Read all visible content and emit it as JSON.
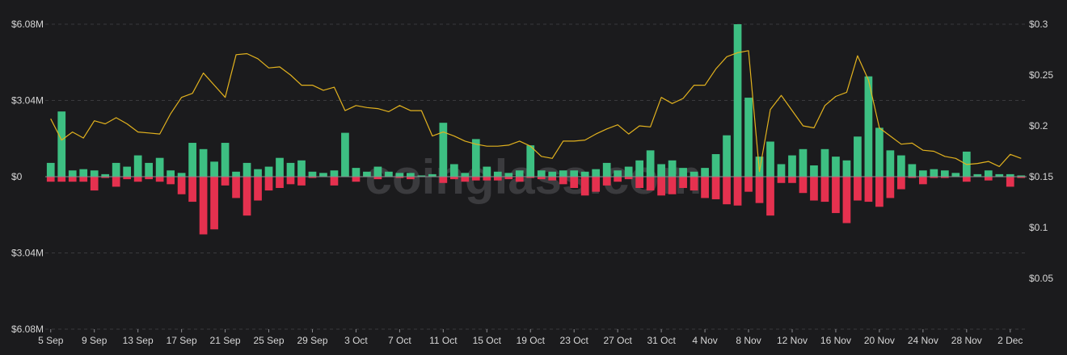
{
  "chart_data": {
    "type": "bar",
    "watermark": "coinglass.com",
    "colors": {
      "positive": "#3dbf82",
      "negative": "#e5314f",
      "price_line": "#e2b21e",
      "background": "#1b1b1d",
      "grid": "#3a3a3d",
      "text": "#d6d6d6"
    },
    "y_left": {
      "ylim": [
        -6.08,
        6.08
      ],
      "ticks": [
        {
          "value": 6.08,
          "label": "$6.08M"
        },
        {
          "value": 3.04,
          "label": "$3.04M"
        },
        {
          "value": 0,
          "label": "$0"
        },
        {
          "value": -3.04,
          "label": "$3.04M"
        },
        {
          "value": -6.08,
          "label": "$6.08M"
        }
      ]
    },
    "y_right": {
      "ylim": [
        0.0,
        0.3
      ],
      "ticks": [
        {
          "value": 0.3,
          "label": "$0.3"
        },
        {
          "value": 0.25,
          "label": "$0.25"
        },
        {
          "value": 0.2,
          "label": "$0.2"
        },
        {
          "value": 0.15,
          "label": "$0.15"
        },
        {
          "value": 0.1,
          "label": "$0.1"
        },
        {
          "value": 0.05,
          "label": "$0.05"
        }
      ]
    },
    "x_tick_labels": [
      {
        "index": 0,
        "label": "5 Sep"
      },
      {
        "index": 4,
        "label": "9 Sep"
      },
      {
        "index": 8,
        "label": "13 Sep"
      },
      {
        "index": 12,
        "label": "17 Sep"
      },
      {
        "index": 16,
        "label": "21 Sep"
      },
      {
        "index": 20,
        "label": "25 Sep"
      },
      {
        "index": 24,
        "label": "29 Sep"
      },
      {
        "index": 28,
        "label": "3 Oct"
      },
      {
        "index": 32,
        "label": "7 Oct"
      },
      {
        "index": 36,
        "label": "11 Oct"
      },
      {
        "index": 40,
        "label": "15 Oct"
      },
      {
        "index": 44,
        "label": "19 Oct"
      },
      {
        "index": 48,
        "label": "23 Oct"
      },
      {
        "index": 52,
        "label": "27 Oct"
      },
      {
        "index": 56,
        "label": "31 Oct"
      },
      {
        "index": 60,
        "label": "4 Nov"
      },
      {
        "index": 64,
        "label": "8 Nov"
      },
      {
        "index": 68,
        "label": "12 Nov"
      },
      {
        "index": 72,
        "label": "16 Nov"
      },
      {
        "index": 76,
        "label": "20 Nov"
      },
      {
        "index": 80,
        "label": "24 Nov"
      },
      {
        "index": 84,
        "label": "28 Nov"
      },
      {
        "index": 88,
        "label": "2 Dec"
      }
    ],
    "long_values": [
      0.55,
      2.6,
      0.25,
      0.3,
      0.25,
      0.1,
      0.55,
      0.4,
      0.85,
      0.55,
      0.75,
      0.25,
      0.15,
      1.35,
      1.1,
      0.6,
      1.35,
      0.2,
      0.55,
      0.3,
      0.4,
      0.75,
      0.55,
      0.65,
      0.2,
      0.15,
      0.25,
      1.75,
      0.35,
      0.2,
      0.4,
      0.2,
      0.15,
      0.15,
      0.05,
      0.1,
      2.15,
      0.5,
      0.15,
      1.5,
      0.4,
      0.2,
      0.15,
      0.25,
      1.25,
      0.25,
      0.2,
      0.25,
      0.25,
      0.2,
      0.3,
      0.55,
      0.25,
      0.4,
      0.65,
      1.05,
      0.5,
      0.65,
      0.35,
      0.2,
      0.35,
      0.9,
      1.65,
      6.08,
      3.15,
      0.8,
      1.4,
      0.5,
      0.85,
      1.1,
      0.45,
      1.1,
      0.8,
      0.65,
      1.6,
      4.0,
      1.95,
      1.05,
      0.85,
      0.5,
      0.25,
      0.3,
      0.25,
      0.15,
      1.0,
      0.1,
      0.25,
      0.1,
      0.1,
      0.05
    ],
    "short_values": [
      -0.2,
      -0.2,
      -0.2,
      -0.2,
      -0.55,
      -0.05,
      -0.4,
      -0.1,
      -0.2,
      -0.1,
      -0.2,
      -0.3,
      -0.7,
      -1.0,
      -2.3,
      -2.1,
      -0.35,
      -0.85,
      -1.55,
      -0.95,
      -0.55,
      -0.45,
      -0.3,
      -0.35,
      -0.05,
      0,
      -0.35,
      0,
      -0.2,
      0,
      -0.1,
      0,
      -0.05,
      -0.1,
      0,
      0,
      -0.25,
      -0.1,
      -0.2,
      -0.15,
      -0.15,
      -0.15,
      -0.1,
      -0.2,
      -0.05,
      -0.1,
      -0.15,
      -0.3,
      -0.45,
      -0.75,
      -0.6,
      -0.35,
      -0.2,
      -0.1,
      -0.45,
      -0.55,
      -0.75,
      -0.7,
      -0.45,
      -0.55,
      -0.85,
      -0.9,
      -1.1,
      -1.15,
      -0.6,
      -1.05,
      -1.55,
      -0.25,
      -0.25,
      -0.65,
      -0.95,
      -1.0,
      -1.45,
      -1.85,
      -0.95,
      -1.0,
      -1.2,
      -0.85,
      -0.5,
      -0.05,
      -0.3,
      -0.05,
      -0.05,
      0,
      -0.2,
      0,
      -0.15,
      0,
      -0.4,
      -0.05
    ],
    "price_values": [
      0.207,
      0.186,
      0.194,
      0.188,
      0.205,
      0.202,
      0.208,
      0.202,
      0.194,
      0.193,
      0.192,
      0.212,
      0.228,
      0.232,
      0.252,
      0.24,
      0.228,
      0.27,
      0.271,
      0.266,
      0.257,
      0.258,
      0.25,
      0.24,
      0.24,
      0.235,
      0.238,
      0.215,
      0.22,
      0.218,
      0.217,
      0.214,
      0.22,
      0.215,
      0.215,
      0.19,
      0.194,
      0.19,
      0.185,
      0.182,
      0.18,
      0.18,
      0.181,
      0.185,
      0.18,
      0.17,
      0.168,
      0.185,
      0.185,
      0.186,
      0.192,
      0.197,
      0.201,
      0.192,
      0.2,
      0.199,
      0.228,
      0.222,
      0.227,
      0.24,
      0.24,
      0.256,
      0.268,
      0.272,
      0.274,
      0.155,
      0.216,
      0.23,
      0.215,
      0.2,
      0.198,
      0.22,
      0.229,
      0.233,
      0.269,
      0.245,
      0.198,
      0.19,
      0.182,
      0.183,
      0.176,
      0.175,
      0.17,
      0.168,
      0.162,
      0.163,
      0.165,
      0.16,
      0.172,
      0.168
    ]
  }
}
